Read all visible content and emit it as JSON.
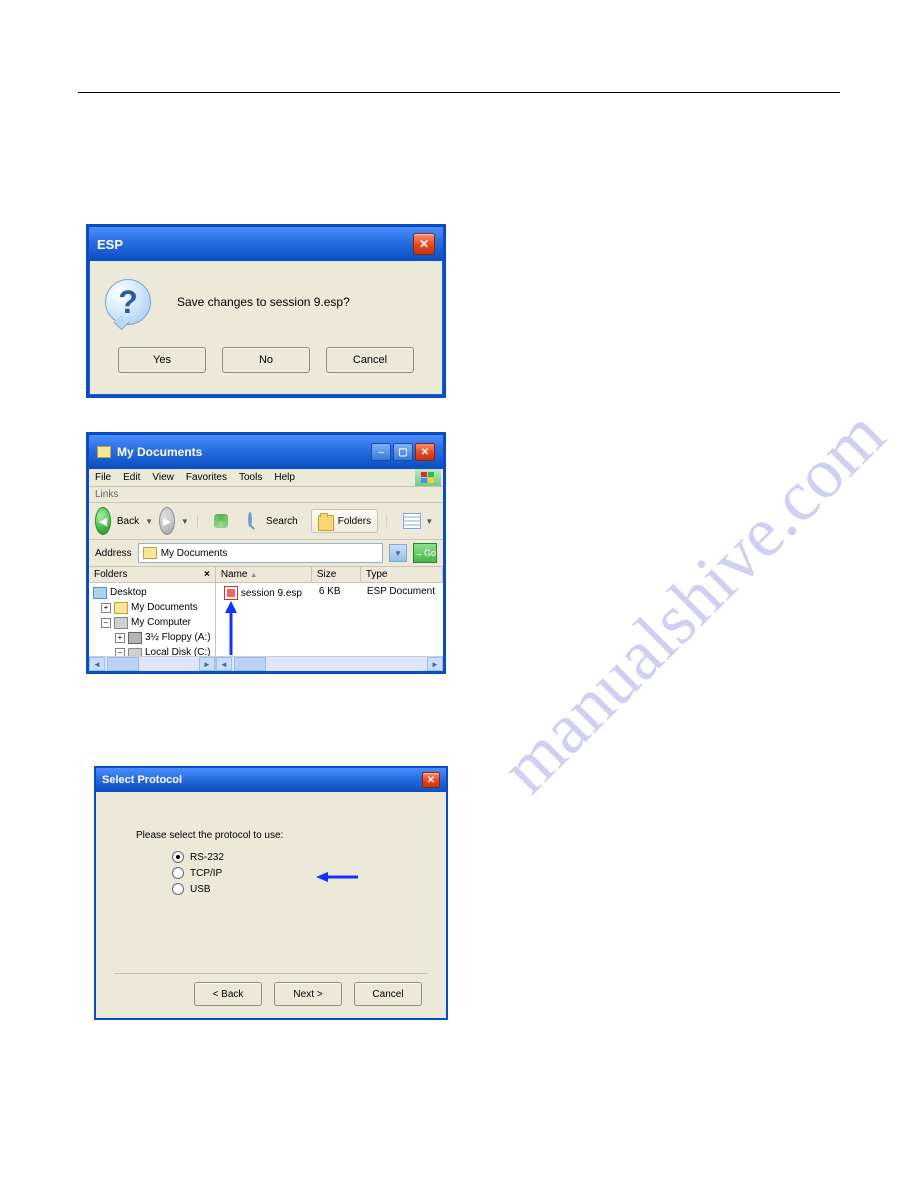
{
  "watermark": "manualshive.com",
  "dialog1": {
    "title": "ESP",
    "message": "Save changes to session 9.esp?",
    "yes": "Yes",
    "no": "No",
    "cancel": "Cancel"
  },
  "explorer": {
    "title": "My Documents",
    "menu": {
      "file": "File",
      "edit": "Edit",
      "view": "View",
      "favorites": "Favorites",
      "tools": "Tools",
      "help": "Help"
    },
    "links": "Links",
    "back": "Back",
    "search": "Search",
    "folders": "Folders",
    "address_label": "Address",
    "address_value": "My Documents",
    "go": "Go",
    "folders_header": "Folders",
    "tree": {
      "desktop": "Desktop",
      "mydocs": "My Documents",
      "mycomp": "My Computer",
      "floppy": "3½ Floppy (A:)",
      "localc": "Local Disk (C:)"
    },
    "columns": {
      "name": "Name",
      "size": "Size",
      "type": "Type"
    },
    "file": {
      "name": "session 9.esp",
      "size": "6 KB",
      "type": "ESP Document"
    }
  },
  "protocol": {
    "title": "Select Protocol",
    "prompt": "Please select the protocol to use:",
    "opt1": "RS-232",
    "opt2": "TCP/IP",
    "opt3": "USB",
    "back": "< Back",
    "next": "Next >",
    "cancel": "Cancel"
  }
}
